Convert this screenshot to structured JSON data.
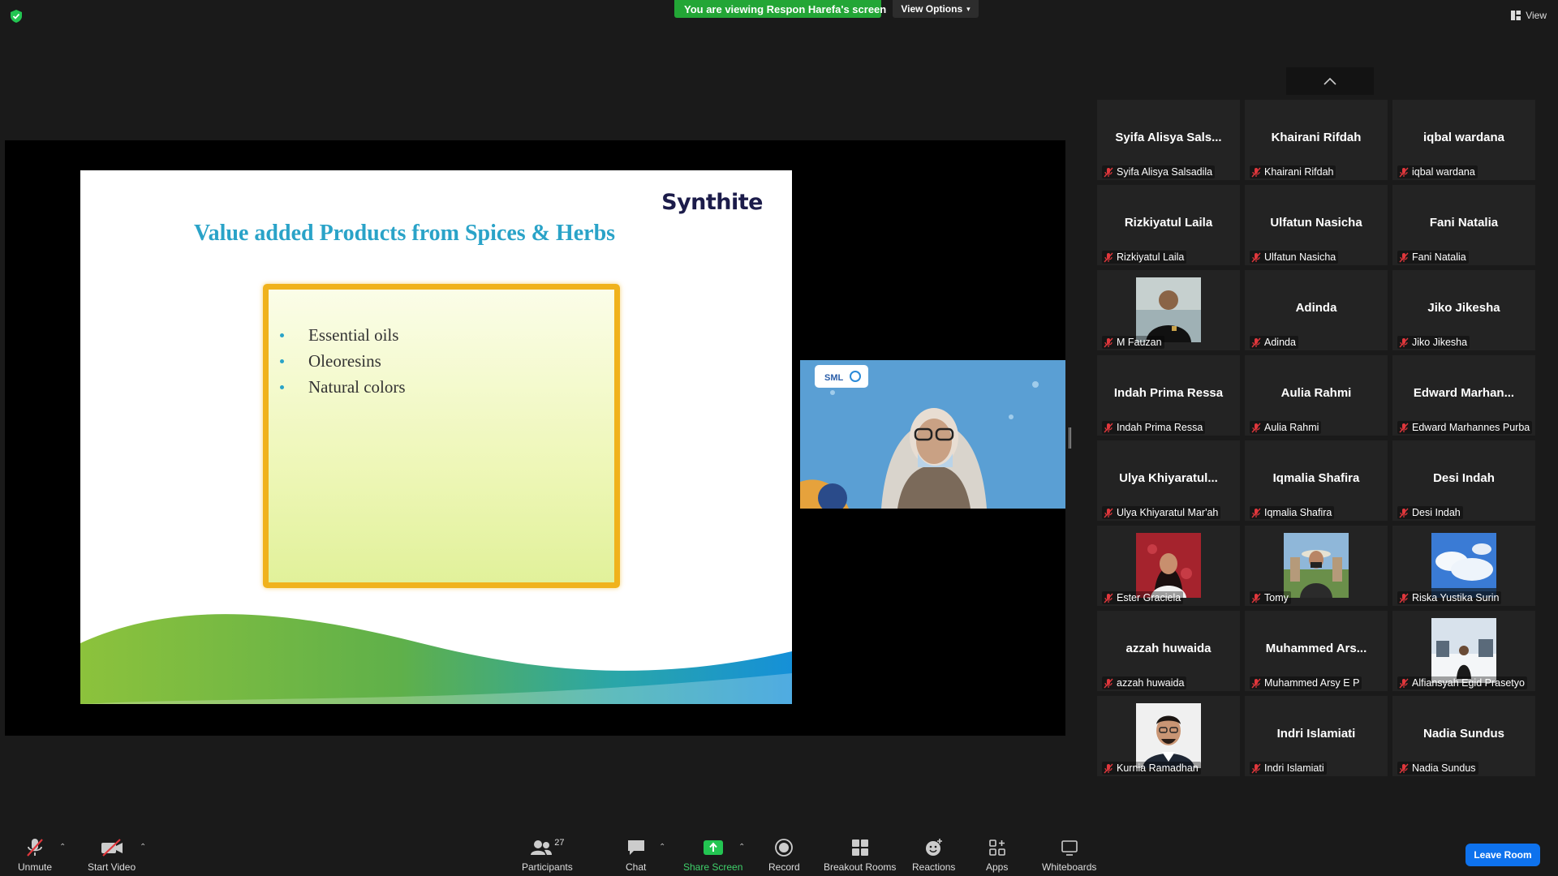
{
  "top": {
    "viewing_banner": "You are viewing Respon Harefa's screen",
    "view_options": "View Options",
    "view": "View"
  },
  "slide": {
    "logo": "Synthite",
    "title": "Value added Products from Spices & Herbs",
    "bullets": [
      "Essential oils",
      "Oleoresins",
      "Natural colors"
    ],
    "speaker_badge": "SML"
  },
  "participants": [
    {
      "big": "Syifa  Alisya  Sals...",
      "label": "Syifa Alisya Salsadila",
      "photo": null
    },
    {
      "big": "Khairani Rifdah",
      "label": "Khairani Rifdah",
      "photo": null
    },
    {
      "big": "iqbal wardana",
      "label": "iqbal wardana",
      "photo": null
    },
    {
      "big": "Rizkiyatul Laila",
      "label": "Rizkiyatul Laila",
      "photo": null
    },
    {
      "big": "Ulfatun Nasicha",
      "label": "Ulfatun Nasicha",
      "photo": null
    },
    {
      "big": "Fani Natalia",
      "label": "Fani Natalia",
      "photo": null
    },
    {
      "big": "",
      "label": "M Fauzan",
      "photo": "person-dark-shirt"
    },
    {
      "big": "Adinda",
      "label": "Adinda",
      "photo": null
    },
    {
      "big": "Jiko Jikesha",
      "label": "Jiko Jikesha",
      "photo": null
    },
    {
      "big": "Indah Prima Ressa",
      "label": "Indah Prima Ressa",
      "photo": null
    },
    {
      "big": "Aulia Rahmi",
      "label": "Aulia Rahmi",
      "photo": null
    },
    {
      "big": "Edward  Marhan...",
      "label": "Edward Marhannes Purba",
      "photo": null
    },
    {
      "big": "Ulya  Khiyaratul...",
      "label": "Ulya Khiyaratul Mar'ah",
      "photo": null
    },
    {
      "big": "Iqmalia Shafira",
      "label": "Iqmalia Shafira",
      "photo": null
    },
    {
      "big": "Desi Indah",
      "label": "Desi Indah",
      "photo": null
    },
    {
      "big": "",
      "label": "Ester Graciela",
      "photo": "person-red-background"
    },
    {
      "big": "",
      "label": "Tomy",
      "photo": "person-hat-outdoor"
    },
    {
      "big": "",
      "label": "Riska Yustika Surin",
      "photo": "blue-sky-clouds"
    },
    {
      "big": "azzah huwaida",
      "label": "azzah huwaida",
      "photo": null
    },
    {
      "big": "Muhammed  Ars...",
      "label": "Muhammed Arsy E P",
      "photo": null
    },
    {
      "big": "",
      "label": "Alfiansyah Egid Prasetyo",
      "photo": "person-snow"
    },
    {
      "big": "",
      "label": "Kurnia Ramadhan",
      "photo": "person-glasses-portrait"
    },
    {
      "big": "Indri Islamiati",
      "label": "Indri Islamiati",
      "photo": null
    },
    {
      "big": "Nadia Sundus",
      "label": "Nadia Sundus",
      "photo": null
    }
  ],
  "toolbar": {
    "unmute": "Unmute",
    "start_video": "Start Video",
    "participants": "Participants",
    "participants_count": "27",
    "chat": "Chat",
    "share_screen": "Share Screen",
    "record": "Record",
    "breakout_rooms": "Breakout Rooms",
    "reactions": "Reactions",
    "apps": "Apps",
    "whiteboards": "Whiteboards",
    "leave_room": "Leave Room"
  },
  "colors": {
    "share_green": "#23a636",
    "leave_blue": "#0e72ed",
    "mic_red": "#e0373c",
    "slide_title": "#2aa3c8",
    "slide_frame": "#f0b21c"
  }
}
